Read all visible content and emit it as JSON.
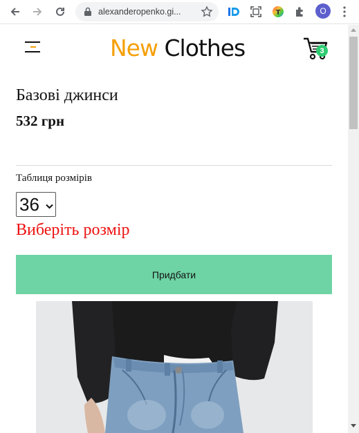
{
  "browser": {
    "url": "alexanderopenko.gi...",
    "profile_initial": "O"
  },
  "site": {
    "brand_accent": "New",
    "brand_main": "Clothes",
    "brand_accent_color": "#f5a00a",
    "cart_count": "3"
  },
  "product": {
    "title": "Базові джинси",
    "price": "532 грн",
    "size_table_label": "Таблиця розмірів",
    "selected_size": "36",
    "size_error": "Виберіть розмір",
    "buy_label": "Придбати",
    "image_icon": "jeans-photo"
  },
  "colors": {
    "buy_button": "#6fd4a5",
    "error": "#ee1111",
    "badge": "#2ecc71"
  }
}
